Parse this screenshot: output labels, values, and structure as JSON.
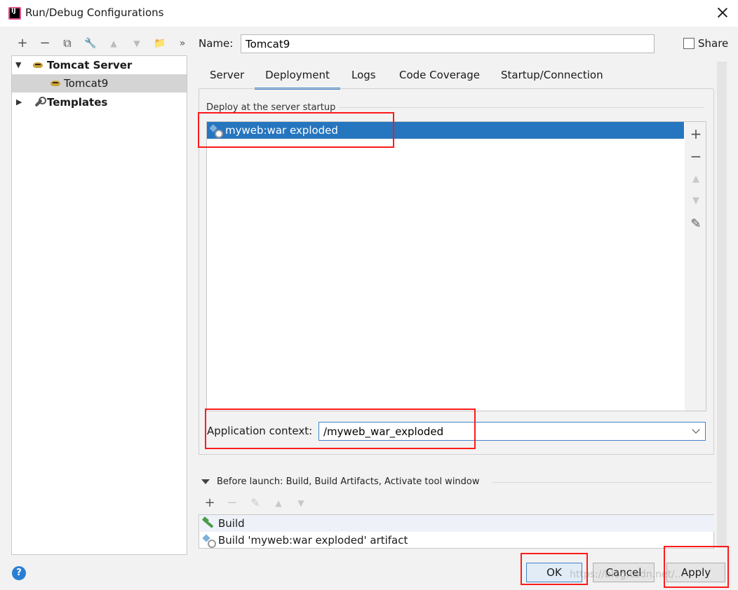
{
  "window": {
    "title": "Run/Debug Configurations"
  },
  "toolbar": {
    "add": "+",
    "remove": "−",
    "copy": "⧉",
    "edit": "🔧",
    "up": "▲",
    "down": "▼",
    "folder": "📁",
    "more": "»"
  },
  "tree": {
    "group": "Tomcat Server",
    "child": "Tomcat9",
    "templates": "Templates"
  },
  "name": {
    "label": "Name:",
    "value": "Tomcat9"
  },
  "share": {
    "label": "Share",
    "checked": false
  },
  "tabs": [
    {
      "label": "Server"
    },
    {
      "label": "Deployment",
      "active": true
    },
    {
      "label": "Logs"
    },
    {
      "label": "Code Coverage"
    },
    {
      "label": "Startup/Connection"
    }
  ],
  "deployment": {
    "section_label": "Deploy at the server startup",
    "items": [
      {
        "label": "myweb:war exploded",
        "selected": true
      }
    ],
    "side_buttons": {
      "add": "+",
      "remove": "−",
      "up": "▲",
      "down": "▼",
      "edit": "✎"
    },
    "context_label": "Application context:",
    "context_value": "/myweb_war_exploded"
  },
  "before_launch": {
    "label": "Before launch: Build, Build Artifacts, Activate tool window",
    "buttons": {
      "add": "+",
      "remove": "−",
      "edit": "✎",
      "up": "▲",
      "down": "▼"
    },
    "items": [
      {
        "label": "Build"
      },
      {
        "label": "Build 'myweb:war exploded' artifact"
      }
    ]
  },
  "buttons": {
    "ok": "OK",
    "cancel": "Cancel",
    "apply": "Apply"
  },
  "help": {
    "label": "?"
  },
  "watermark": "https://blog.csdn.net/..."
}
